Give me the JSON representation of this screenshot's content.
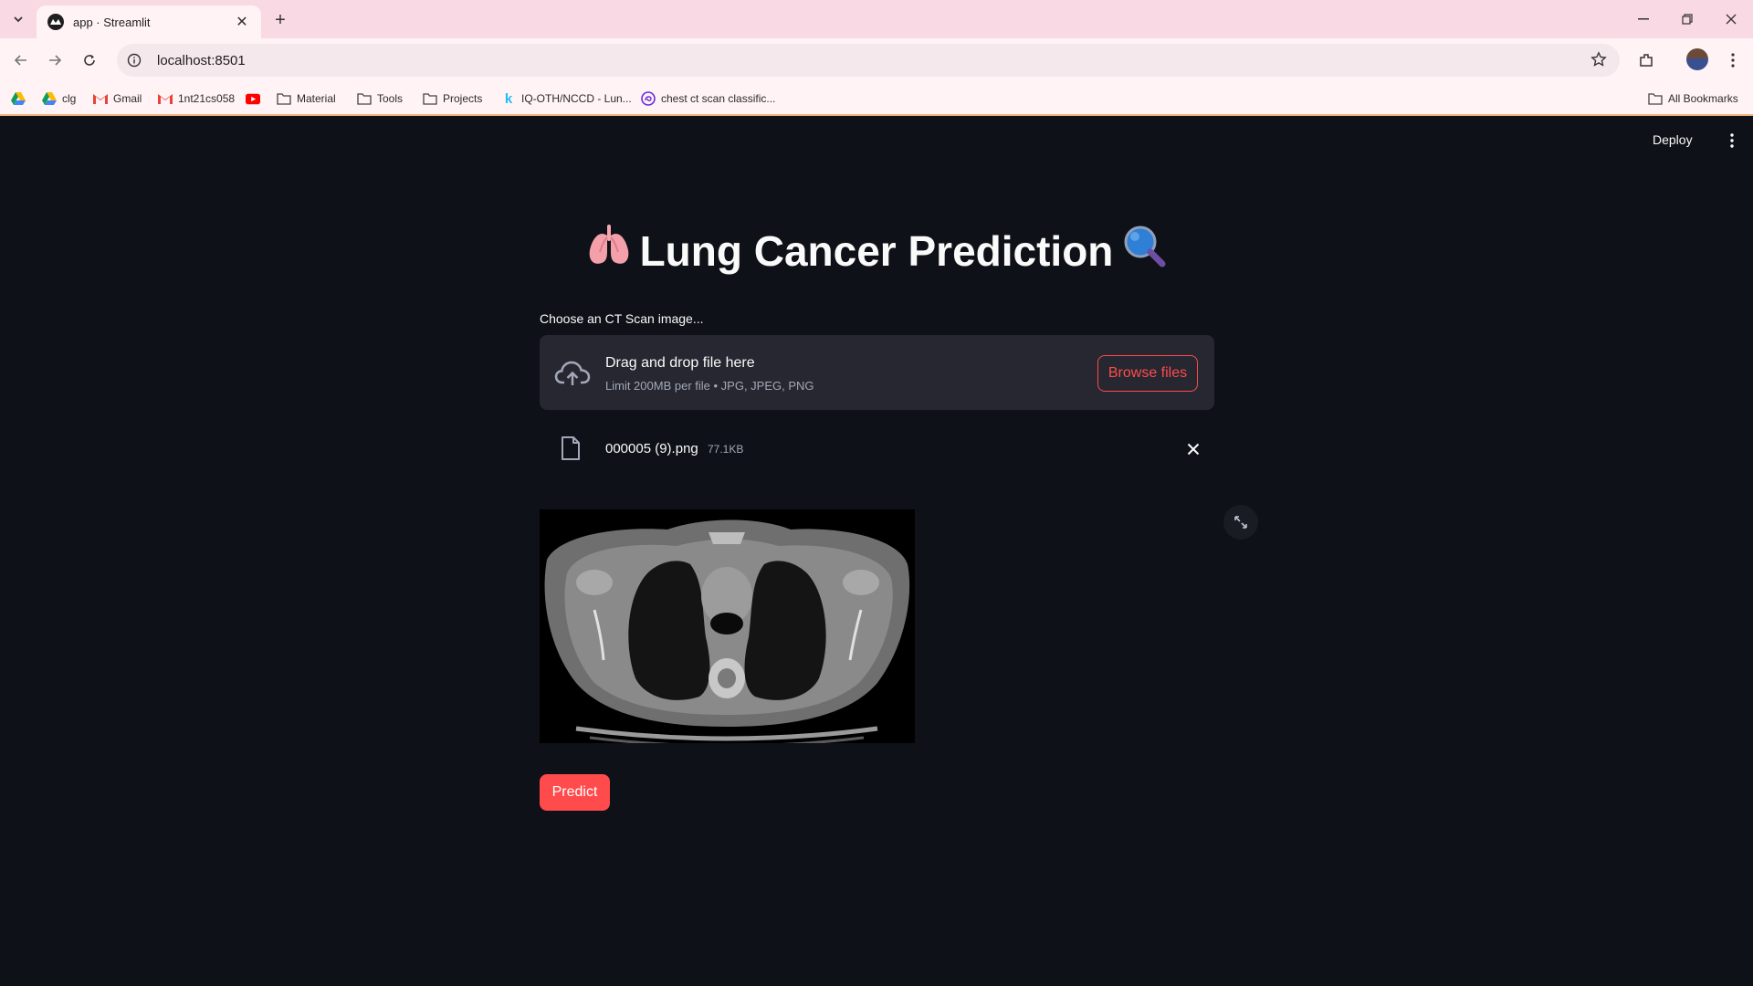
{
  "browser": {
    "tab_title": "app · Streamlit",
    "url": "localhost:8501",
    "bookmarks": [
      {
        "label": "",
        "icon": "google-drive-icon"
      },
      {
        "label": "clg",
        "icon": "google-drive-icon"
      },
      {
        "label": "Gmail",
        "icon": "gmail-icon"
      },
      {
        "label": "1nt21cs058",
        "icon": "gmail-icon"
      },
      {
        "label": "",
        "icon": "youtube-icon"
      },
      {
        "label": "Material",
        "icon": "folder-icon"
      },
      {
        "label": "Tools",
        "icon": "folder-icon"
      },
      {
        "label": "Projects",
        "icon": "folder-icon"
      },
      {
        "label": "IQ-OTH/NCCD - Lun...",
        "icon": "kaggle-icon"
      },
      {
        "label": "chest ct scan classific...",
        "icon": "site-icon"
      }
    ],
    "all_bookmarks": "All Bookmarks"
  },
  "app": {
    "deploy_label": "Deploy",
    "title": "Lung Cancer Prediction",
    "title_icons": [
      "lungs-icon",
      "magnifier-icon"
    ],
    "uploader": {
      "label": "Choose an CT Scan image...",
      "drop_title": "Drag and drop file here",
      "limit_text": "Limit 200MB per file • JPG, JPEG, PNG",
      "browse_label": "Browse files"
    },
    "file": {
      "name": "000005 (9).png",
      "size": "77.1KB"
    },
    "predict_label": "Predict"
  },
  "colors": {
    "background": "#0e1117",
    "accent": "#ff4b4b",
    "dropzone": "#262730",
    "browser_tabstrip": "#f9d9e3"
  }
}
